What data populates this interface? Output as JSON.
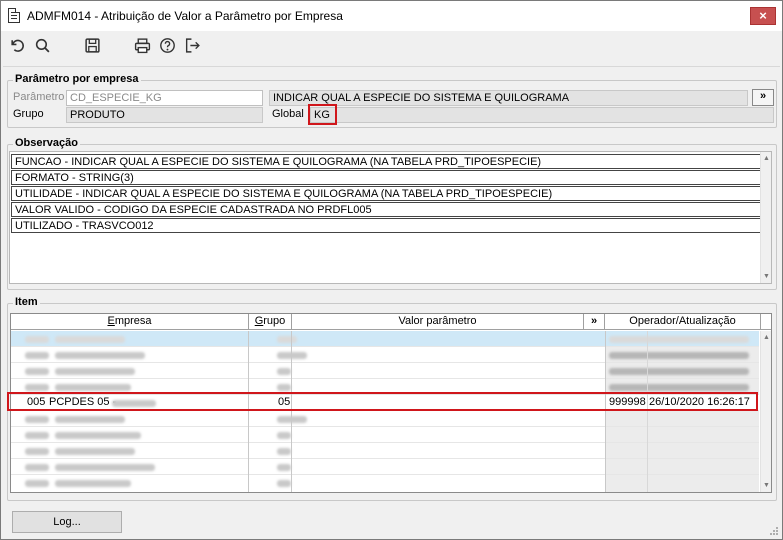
{
  "window": {
    "title": "ADMFM014 - Atribuição de Valor a Parâmetro por Empresa",
    "close_label": "×"
  },
  "toolbar": [
    {
      "name": "undo-icon",
      "label": "Desfazer"
    },
    {
      "name": "search-icon",
      "label": "Pesquisar"
    },
    {
      "name": "save-icon",
      "label": "Salvar"
    },
    {
      "name": "print-icon",
      "label": "Imprimir"
    },
    {
      "name": "help-icon",
      "label": "Ajuda"
    },
    {
      "name": "exit-icon",
      "label": "Sair"
    }
  ],
  "parametro_group": {
    "title": "Parâmetro por empresa",
    "parametro_label": "Parâmetro",
    "parametro_value": "CD_ESPECIE_KG",
    "descricao_value": "INDICAR QUAL A ESPECIE DO SISTEMA E QUILOGRAMA",
    "more_button": "»",
    "grupo_label": "Grupo",
    "grupo_value": "PRODUTO",
    "global_label": "Global",
    "global_value": "KG"
  },
  "observacao": {
    "title": "Observação",
    "lines": [
      "FUNCAO -  INDICAR QUAL A ESPECIE DO SISTEMA E QUILOGRAMA (NA TABELA PRD_TIPOESPECIE)",
      "FORMATO - STRING(3)",
      "UTILIDADE -  INDICAR QUAL A ESPECIE DO SISTEMA E QUILOGRAMA (NA TABELA PRD_TIPOESPECIE)",
      "VALOR VALIDO - CODIGO DA ESPECIE CADASTRADA NO PRDFL005",
      "UTILIZADO - TRASVCO012"
    ]
  },
  "item": {
    "title": "Item",
    "columns": {
      "empresa": "Empresa",
      "grupo": "Grupo",
      "valor": "Valor parâmetro",
      "more": "»",
      "operador": "Operador/Atualização"
    },
    "highlighted_row": {
      "codigo": "005",
      "empresa": "PCPDES 05 -",
      "grupo": "05",
      "valor": "",
      "operador": "999998",
      "atualizacao": "26/10/2020 16:26:17"
    }
  },
  "footer": {
    "log_label": "Log..."
  },
  "colors": {
    "highlight_border": "#d0161b",
    "selected_row": "#cfe8f7",
    "close_button": "#c75050"
  }
}
